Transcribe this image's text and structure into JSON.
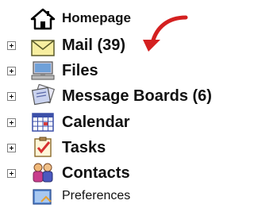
{
  "nav": {
    "items": [
      {
        "label": "Homepage",
        "icon": "home-icon",
        "expandable": false
      },
      {
        "label": "Mail (39)",
        "icon": "envelope-icon",
        "expandable": true
      },
      {
        "label": "Files",
        "icon": "computer-icon",
        "expandable": true
      },
      {
        "label": "Message Boards (6)",
        "icon": "message-board-icon",
        "expandable": true
      },
      {
        "label": "Calendar",
        "icon": "calendar-icon",
        "expandable": true
      },
      {
        "label": "Tasks",
        "icon": "tasks-icon",
        "expandable": true
      },
      {
        "label": "Contacts",
        "icon": "contacts-icon",
        "expandable": true
      },
      {
        "label": "Preferences",
        "icon": "preferences-icon",
        "expandable": false
      }
    ]
  },
  "annotation": {
    "icon": "red-curved-arrow-icon",
    "color": "#d42020"
  }
}
